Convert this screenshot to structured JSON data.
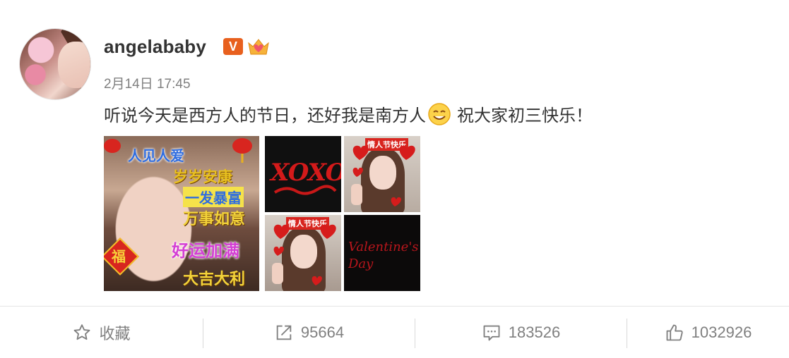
{
  "post": {
    "username": "angelababy",
    "verified_badge": "V",
    "member_badge": "crown-heart-icon",
    "time": "2月14日 17:45",
    "text_before": "听说今天是西方人的节日，还好我是南方人",
    "emoji": "smile-emoji-icon",
    "text_after": "祝大家初三快乐！"
  },
  "images": {
    "pic1": {
      "caption_top": "人见人爱",
      "lines": [
        "岁岁安康",
        "一发暴富",
        "万事如意",
        "好运加满",
        "大吉大利"
      ],
      "fu": "福"
    },
    "pic2": {
      "text": "XOXO"
    },
    "pic3": {
      "banner": "情人节快乐"
    },
    "pic4": {
      "banner": "情人节快乐"
    },
    "pic5": {
      "text": "Valentine's Day"
    }
  },
  "actions": {
    "favorite": {
      "label": "收藏",
      "icon": "star-icon"
    },
    "repost": {
      "count": "95664",
      "icon": "share-icon"
    },
    "comment": {
      "count": "183526",
      "icon": "comment-icon"
    },
    "like": {
      "count": "1032926",
      "icon": "thumbs-up-icon"
    }
  },
  "colors": {
    "text": "#333333",
    "meta": "#808080",
    "vip": "#e8601e",
    "divider": "#e6e6e6"
  }
}
